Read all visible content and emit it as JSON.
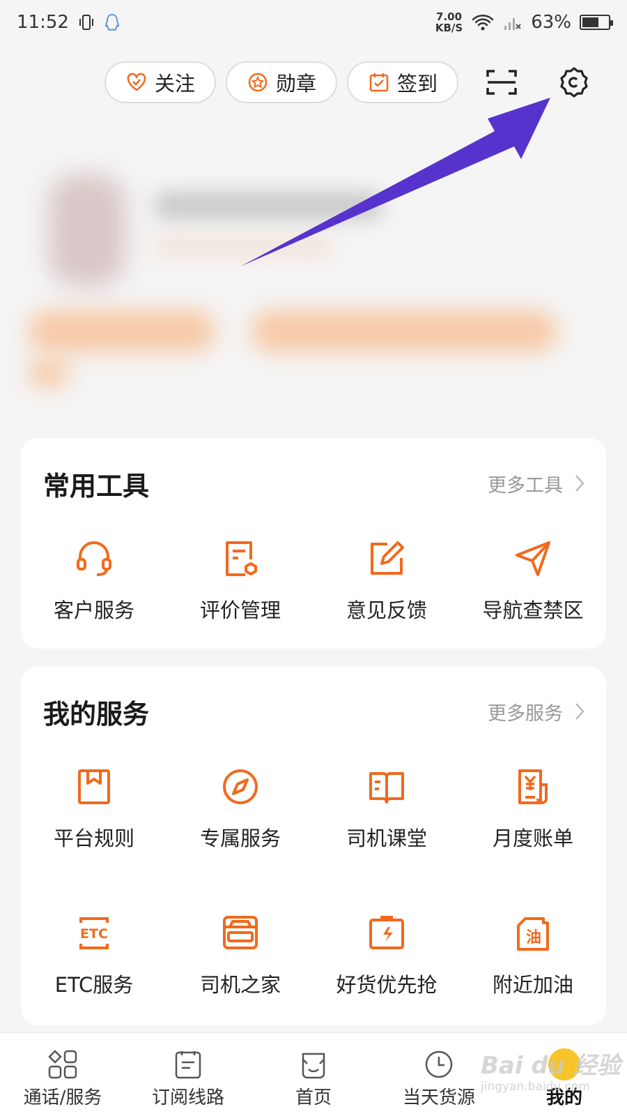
{
  "status_bar": {
    "time": "11:52",
    "net_speed_value": "7.00",
    "net_speed_unit": "KB/S",
    "battery": "63%",
    "battery_level": 0.63
  },
  "top_actions": {
    "follow_label": "关注",
    "medal_label": "勋章",
    "checkin_label": "签到"
  },
  "accent_color": "#f06a1d",
  "annotation_color": "#5533cc",
  "tools": {
    "title": "常用工具",
    "more": "更多工具",
    "items": [
      {
        "label": "客户服务",
        "icon": "headset-icon"
      },
      {
        "label": "评价管理",
        "icon": "review-icon"
      },
      {
        "label": "意见反馈",
        "icon": "edit-icon"
      },
      {
        "label": "导航查禁区",
        "icon": "navigation-icon"
      }
    ]
  },
  "services": {
    "title": "我的服务",
    "more": "更多服务",
    "items": [
      {
        "label": "平台规则",
        "icon": "bookmark-icon"
      },
      {
        "label": "专属服务",
        "icon": "compass-icon"
      },
      {
        "label": "司机课堂",
        "icon": "book-icon"
      },
      {
        "label": "月度账单",
        "icon": "bill-icon"
      },
      {
        "label": "ETC服务",
        "icon": "etc-icon",
        "icon_text": "ETC"
      },
      {
        "label": "司机之家",
        "icon": "truck-icon"
      },
      {
        "label": "好货优先抢",
        "icon": "package-icon"
      },
      {
        "label": "附近加油",
        "icon": "fuel-icon",
        "icon_text": "油"
      }
    ]
  },
  "bottom_nav": [
    {
      "label": "通话/服务",
      "icon": "grid-icon"
    },
    {
      "label": "订阅线路",
      "icon": "list-icon"
    },
    {
      "label": "首页",
      "icon": "home-icon"
    },
    {
      "label": "当天货源",
      "icon": "clock-icon"
    },
    {
      "label": "我的",
      "icon": "profile-icon",
      "active": true
    }
  ],
  "watermark": {
    "text": "Bai du 经验",
    "sub": "jingyan.baidu.com"
  }
}
